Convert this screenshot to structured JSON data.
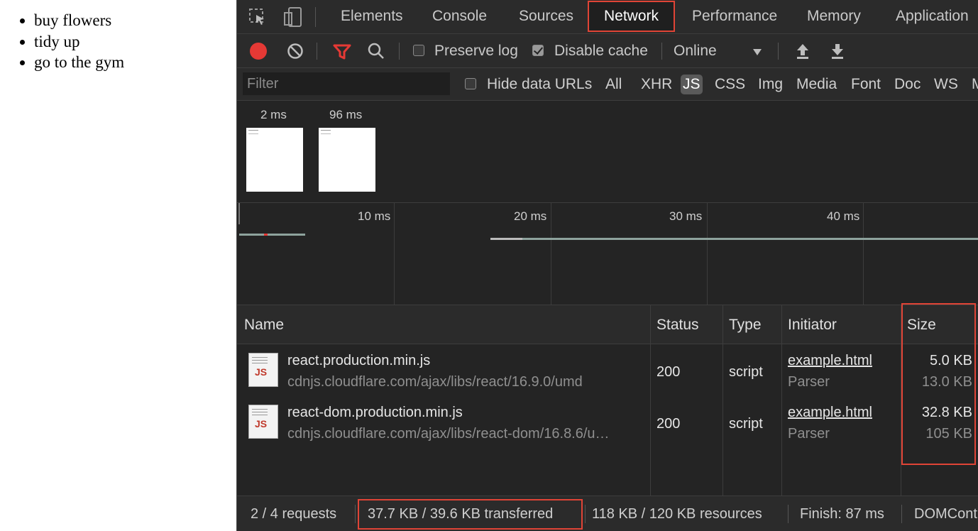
{
  "page": {
    "list_items": [
      "buy flowers",
      "tidy up",
      "go to the gym"
    ]
  },
  "devtools": {
    "tabs": {
      "elements": "Elements",
      "console": "Console",
      "sources": "Sources",
      "network": "Network",
      "performance": "Performance",
      "memory": "Memory",
      "application": "Application"
    },
    "active_tab": "Network",
    "toolbar": {
      "preserve_log": "Preserve log",
      "preserve_log_checked": false,
      "disable_cache": "Disable cache",
      "disable_cache_checked": true,
      "throttling": "Online"
    },
    "filter": {
      "placeholder": "Filter",
      "hide_data_urls": "Hide data URLs",
      "types": [
        "All",
        "XHR",
        "JS",
        "CSS",
        "Img",
        "Media",
        "Font",
        "Doc",
        "WS",
        "M"
      ],
      "selected_type": "JS"
    },
    "screenshots": [
      {
        "time": "2 ms"
      },
      {
        "time": "96 ms"
      }
    ],
    "timeline_ticks": [
      "10 ms",
      "20 ms",
      "30 ms",
      "40 ms"
    ],
    "columns": {
      "name": "Name",
      "status": "Status",
      "type": "Type",
      "initiator": "Initiator",
      "size": "Size"
    },
    "requests": [
      {
        "name": "react.production.min.js",
        "path": "cdnjs.cloudflare.com/ajax/libs/react/16.9.0/umd",
        "status": "200",
        "type": "script",
        "initiator": "example.html",
        "initiator_sub": "Parser",
        "size": "5.0 KB",
        "size_sub": "13.0 KB",
        "icon": "js-file-icon"
      },
      {
        "name": "react-dom.production.min.js",
        "path": "cdnjs.cloudflare.com/ajax/libs/react-dom/16.8.6/u…",
        "status": "200",
        "type": "script",
        "initiator": "example.html",
        "initiator_sub": "Parser",
        "size": "32.8 KB",
        "size_sub": "105 KB",
        "icon": "js-file-icon"
      }
    ],
    "status_bar": {
      "requests": "2 / 4 requests",
      "transferred": "37.7 KB / 39.6 KB transferred",
      "resources": "118 KB / 120 KB resources",
      "finish": "Finish: 87 ms",
      "domcontent": "DOMCont"
    },
    "colors": {
      "record": "#e53935",
      "filter_icon": "#e53935",
      "highlight": "#e04436"
    }
  }
}
